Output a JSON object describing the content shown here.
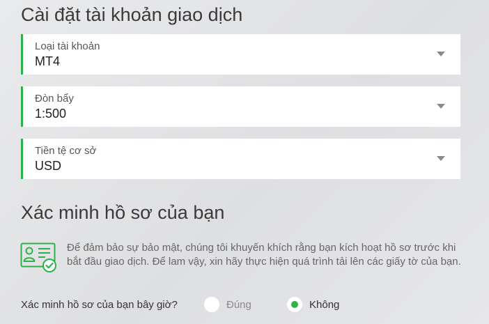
{
  "account_settings": {
    "title": "Cài đặt tài khoản giao dịch",
    "fields": [
      {
        "label": "Loại tài khoản",
        "value": "MT4"
      },
      {
        "label": "Đòn bẩy",
        "value": "1:500"
      },
      {
        "label": "Tiền tệ cơ sở",
        "value": "USD"
      }
    ]
  },
  "verification": {
    "title": "Xác minh hồ sơ của bạn",
    "info_text": "Để đảm bảo sự bảo mật, chúng tôi khuyến khích rằng bạn kích hoạt hồ sơ trước khi bắt đầu giao dịch. Để lam vậy, xin hãy thực hiện quá trình tải lên các giấy tờ của bạn.",
    "question": "Xác minh hồ sơ của bạn bây giờ?",
    "options": [
      {
        "label": "Đúng",
        "selected": false
      },
      {
        "label": "Không",
        "selected": true
      }
    ],
    "icon": "id-card-check-icon"
  },
  "colors": {
    "accent": "#2db14a",
    "background": "#e4e5e8",
    "field_background": "#ffffff"
  }
}
